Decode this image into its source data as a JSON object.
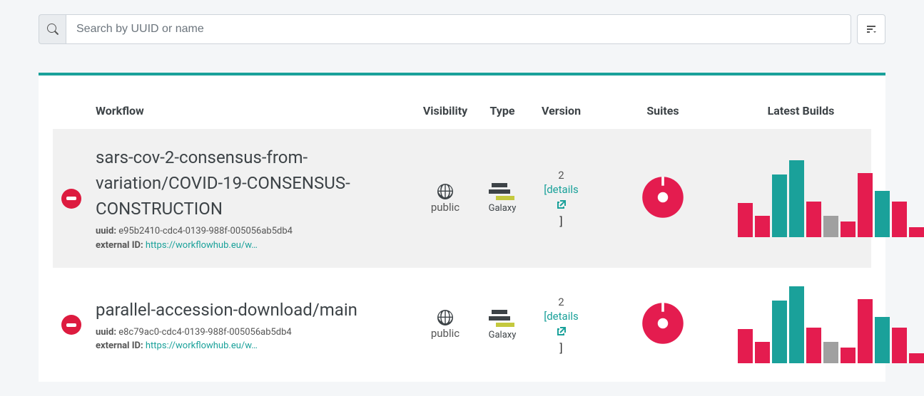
{
  "search": {
    "placeholder": "Search by UUID or name",
    "value": ""
  },
  "columns": {
    "workflow": "Workflow",
    "visibility": "Visibility",
    "type": "Type",
    "version": "Version",
    "suites": "Suites",
    "builds": "Latest Builds"
  },
  "rows": [
    {
      "status": "fail",
      "title": "sars-cov-2-consensus-from-variation/COVID-19-CONSENSUS-CONSTRUCTION",
      "uuid_label": "uuid:",
      "uuid": "e95b2410-cdc4-0139-988f-005056ab5db4",
      "external_id_label": "external ID:",
      "external_id_link": "https://workflowhub.eu/w…",
      "visibility": "public",
      "type_text": "Galaxy",
      "version": "2",
      "details_label": "[details",
      "suite_color": "#e41c4f",
      "builds": [
        {
          "h": 48,
          "c": "red"
        },
        {
          "h": 30,
          "c": "red"
        },
        {
          "h": 88,
          "c": "teal"
        },
        {
          "h": 108,
          "c": "teal"
        },
        {
          "h": 50,
          "c": "red"
        },
        {
          "h": 30,
          "c": "gray"
        },
        {
          "h": 22,
          "c": "red"
        },
        {
          "h": 90,
          "c": "red"
        },
        {
          "h": 65,
          "c": "teal"
        },
        {
          "h": 50,
          "c": "red"
        },
        {
          "h": 14,
          "c": "red"
        }
      ]
    },
    {
      "status": "fail",
      "title": "parallel-accession-download/main",
      "uuid_label": "uuid:",
      "uuid": "e8c79ac0-cdc4-0139-988f-005056ab5db4",
      "external_id_label": "external ID:",
      "external_id_link": "https://workflowhub.eu/w…",
      "visibility": "public",
      "type_text": "Galaxy",
      "version": "2",
      "details_label": "[details",
      "suite_color": "#e41c4f",
      "builds": [
        {
          "h": 48,
          "c": "red"
        },
        {
          "h": 30,
          "c": "red"
        },
        {
          "h": 88,
          "c": "teal"
        },
        {
          "h": 108,
          "c": "teal"
        },
        {
          "h": 50,
          "c": "red"
        },
        {
          "h": 30,
          "c": "gray"
        },
        {
          "h": 22,
          "c": "red"
        },
        {
          "h": 90,
          "c": "red"
        },
        {
          "h": 65,
          "c": "teal"
        },
        {
          "h": 50,
          "c": "red"
        },
        {
          "h": 14,
          "c": "red"
        }
      ]
    }
  ],
  "chart_data": [
    {
      "type": "bar",
      "title": "Latest Builds — row 1",
      "values": [
        48,
        30,
        88,
        108,
        50,
        30,
        22,
        90,
        65,
        50,
        14
      ],
      "colors": [
        "red",
        "red",
        "teal",
        "teal",
        "red",
        "gray",
        "red",
        "red",
        "teal",
        "red",
        "red"
      ]
    },
    {
      "type": "bar",
      "title": "Latest Builds — row 2",
      "values": [
        48,
        30,
        88,
        108,
        50,
        30,
        22,
        90,
        65,
        50,
        14
      ],
      "colors": [
        "red",
        "red",
        "teal",
        "teal",
        "red",
        "gray",
        "red",
        "red",
        "teal",
        "red",
        "red"
      ]
    }
  ]
}
